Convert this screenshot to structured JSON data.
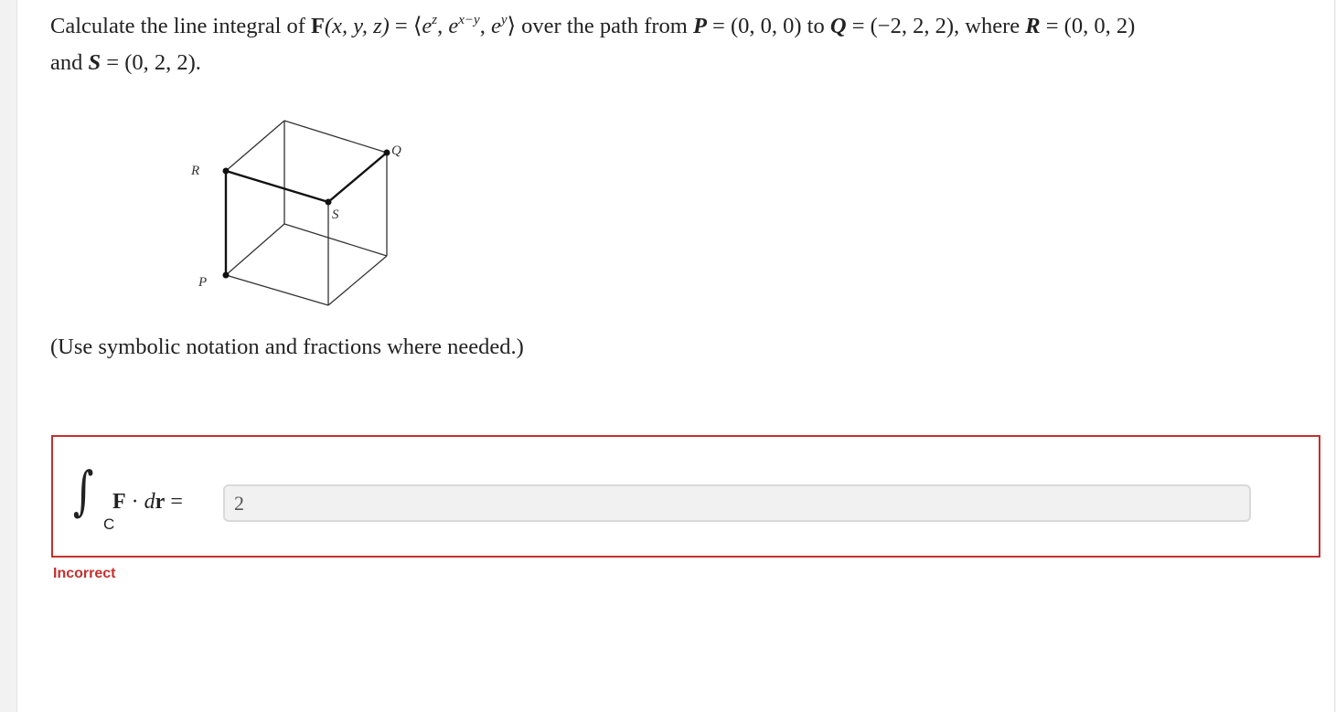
{
  "question": {
    "intro": "Calculate the line integral of ",
    "field_symbol": "F",
    "field_args": "(x, y, z)",
    "eq": " = ⟨",
    "comp1_base": "e",
    "comp1_exp": "z",
    "sep1": ", ",
    "comp2_base": "e",
    "comp2_exp": "x−y",
    "sep2": ", ",
    "comp3_base": "e",
    "comp3_exp": "y",
    "close": "⟩",
    "path_text": " over the path from ",
    "p_label": "P",
    "p_value": " = (0, 0, 0) to ",
    "q_label": "Q",
    "q_value": " = (−2, 2, 2), where ",
    "r_label": "R",
    "r_value": " = (0, 0, 2)",
    "and_text": "and ",
    "s_label": "S",
    "s_value": " = (0, 2, 2)."
  },
  "figure": {
    "label_r": "R",
    "label_s": "S",
    "label_q": "Q",
    "label_p": "P"
  },
  "hint": "(Use symbolic notation and fractions where needed.)",
  "answer": {
    "integral_subscript": "C",
    "field_symbol": "F",
    "dot": " · ",
    "dr_d": "d",
    "dr_r": "r",
    "equals": " =",
    "value": "2"
  },
  "feedback": {
    "status": "Incorrect",
    "color": "#c62f2f"
  }
}
